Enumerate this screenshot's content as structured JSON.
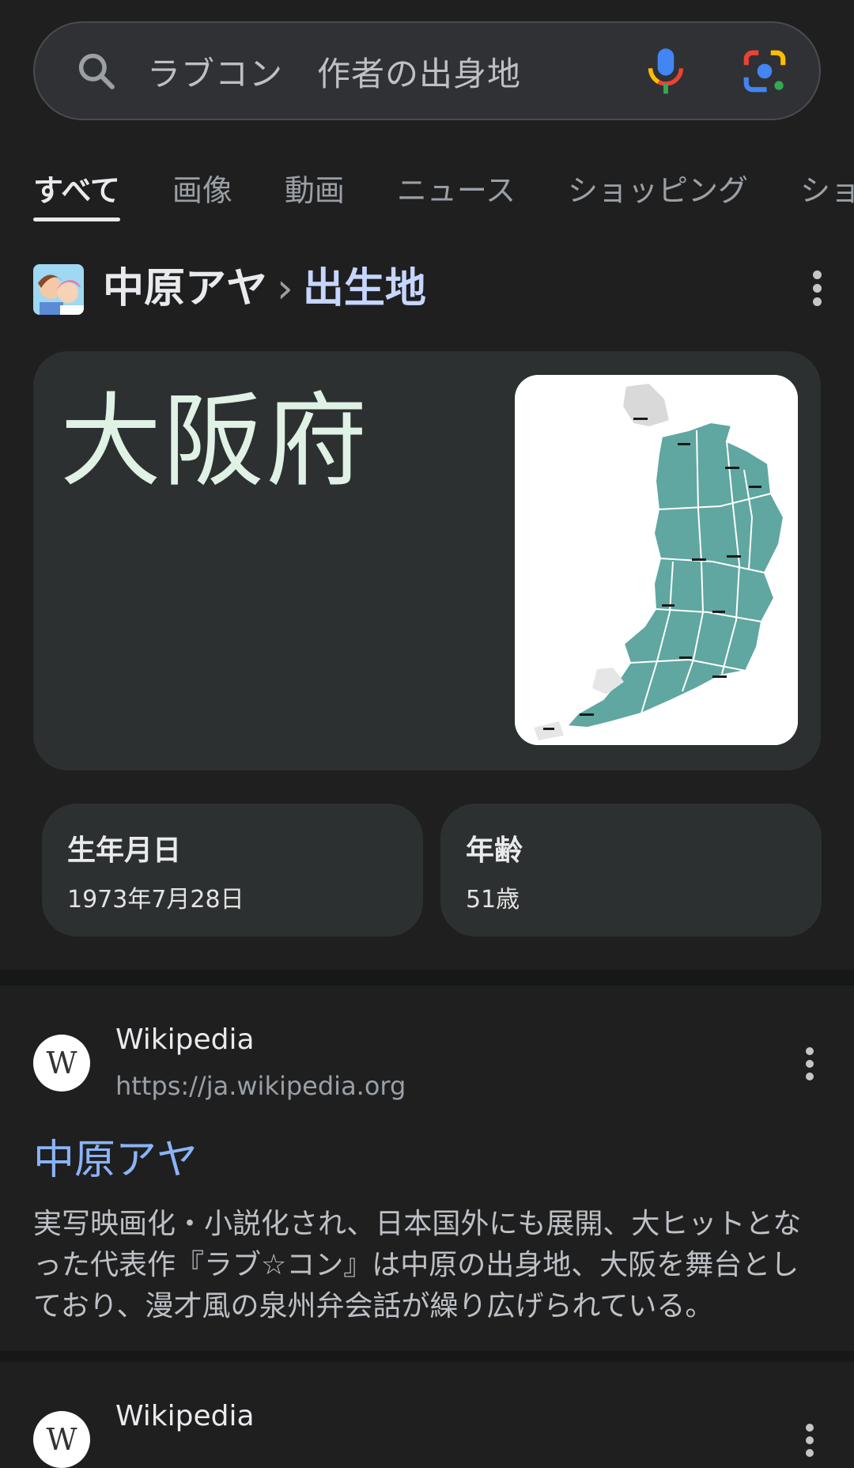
{
  "search": {
    "query": "ラブコン　作者の出身地"
  },
  "tabs": [
    {
      "label": "すべて",
      "active": true
    },
    {
      "label": "画像"
    },
    {
      "label": "動画"
    },
    {
      "label": "ニュース"
    },
    {
      "label": "ショッピング"
    },
    {
      "label": "ショー"
    }
  ],
  "entity": {
    "name": "中原アヤ",
    "separator": "›",
    "attribute": "出生地"
  },
  "answer": {
    "value": "大阪府"
  },
  "facts": [
    {
      "label": "生年月日",
      "value": "1973年7月28日"
    },
    {
      "label": "年齢",
      "value": "51歳"
    }
  ],
  "results": [
    {
      "site_name": "Wikipedia",
      "url": "https://ja.wikipedia.org",
      "favicon": "W",
      "title": "中原アヤ",
      "snippet": "実写映画化・小説化され、日本国外にも展開、大ヒットとなった代表作『ラブ☆コン』は中原の出身地、大阪を舞台としており、漫才風の泉州弁会話が繰り広げられている。"
    },
    {
      "site_name": "Wikipedia",
      "favicon": "W"
    }
  ],
  "colors": {
    "background": "#1f1f1f",
    "card": "#2d3030",
    "link": "#8ab4f8",
    "map_fill": "#5fa7a0"
  }
}
